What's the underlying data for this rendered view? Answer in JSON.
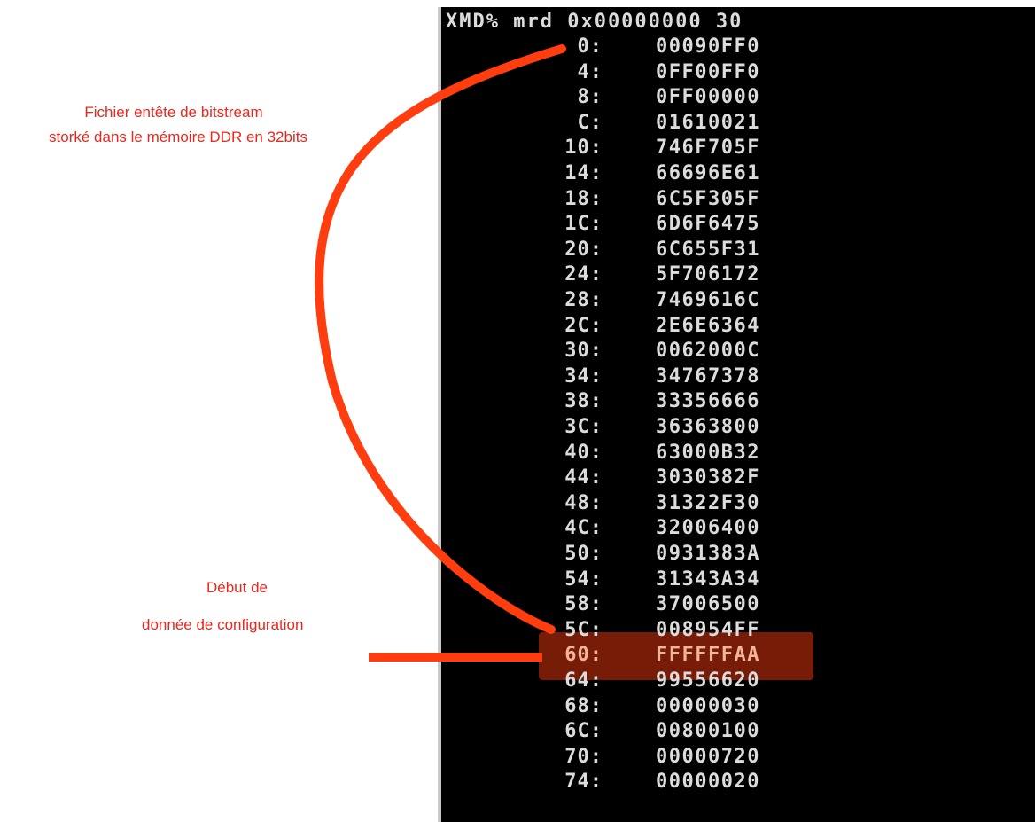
{
  "terminal": {
    "command": "XMD% mrd 0x00000000 30",
    "rows": [
      {
        "addr": "0:",
        "value": "00090FF0"
      },
      {
        "addr": "4:",
        "value": "0FF00FF0"
      },
      {
        "addr": "8:",
        "value": "0FF00000"
      },
      {
        "addr": "C:",
        "value": "01610021"
      },
      {
        "addr": "10:",
        "value": "746F705F"
      },
      {
        "addr": "14:",
        "value": "66696E61"
      },
      {
        "addr": "18:",
        "value": "6C5F305F"
      },
      {
        "addr": "1C:",
        "value": "6D6F6475"
      },
      {
        "addr": "20:",
        "value": "6C655F31"
      },
      {
        "addr": "24:",
        "value": "5F706172"
      },
      {
        "addr": "28:",
        "value": "7469616C"
      },
      {
        "addr": "2C:",
        "value": "2E6E6364"
      },
      {
        "addr": "30:",
        "value": "0062000C"
      },
      {
        "addr": "34:",
        "value": "34767378"
      },
      {
        "addr": "38:",
        "value": "33356666"
      },
      {
        "addr": "3C:",
        "value": "36363800"
      },
      {
        "addr": "40:",
        "value": "63000B32"
      },
      {
        "addr": "44:",
        "value": "3030382F"
      },
      {
        "addr": "48:",
        "value": "31322F30"
      },
      {
        "addr": "4C:",
        "value": "32006400"
      },
      {
        "addr": "50:",
        "value": "0931383A"
      },
      {
        "addr": "54:",
        "value": "31343A34"
      },
      {
        "addr": "58:",
        "value": "37006500"
      },
      {
        "addr": "5C:",
        "value": "008954FF"
      },
      {
        "addr": "60:",
        "value": "FFFFFFAA",
        "highlight": true
      },
      {
        "addr": "64:",
        "value": "99556620"
      },
      {
        "addr": "68:",
        "value": "00000030"
      },
      {
        "addr": "6C:",
        "value": "00800100"
      },
      {
        "addr": "70:",
        "value": "00000720"
      },
      {
        "addr": "74:",
        "value": "00000020"
      }
    ]
  },
  "annotations": {
    "header_note_line1": "Fichier entête de bitstream",
    "header_note_line2": "storké dans le mémoire DDR en 32bits",
    "config_note_line1": "Début de",
    "config_note_line2": "donnée de configuration"
  },
  "colors": {
    "terminal_bg": "#000000",
    "terminal_text": "#dcdcdc",
    "annotation_red": "#e8281e",
    "highlight": "#a5280a",
    "arrow": "#ff3d0e"
  }
}
